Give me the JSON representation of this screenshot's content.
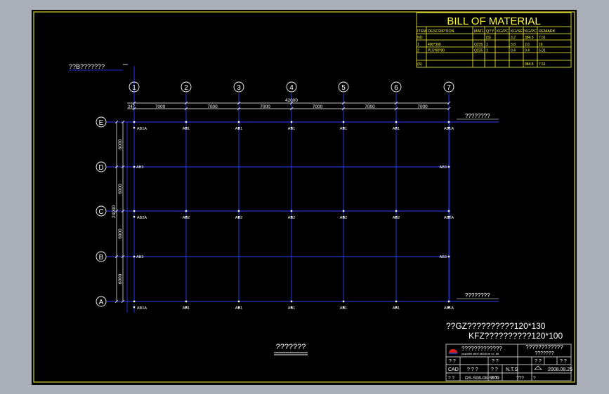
{
  "bom": {
    "title": "BILL OF MATERIAL",
    "headers": [
      "ITEM",
      "DESCRIPTION",
      "MATL",
      "QTY",
      "KG/PC",
      "KG/SET",
      "KG/PC",
      "REMARK"
    ],
    "row0": [
      "NO",
      "",
      "",
      "(S)",
      "",
      "3.2",
      "384.5",
      "7.51"
    ],
    "rows": [
      [
        "1",
        "400*300",
        "Q235",
        "1",
        "",
        "3.8",
        "2.6",
        "16"
      ],
      [
        "2",
        "PL5*80*80",
        "Q235",
        "1",
        "",
        "0.4",
        "0.4",
        "5.01"
      ]
    ],
    "total": [
      "(S)",
      "",
      "",
      "",
      "",
      "",
      "384.5",
      "7.51"
    ]
  },
  "drawing": {
    "top_note": "??B???????",
    "col_labels": [
      "1",
      "2",
      "3",
      "4",
      "5",
      "6",
      "7"
    ],
    "row_labels": [
      "E",
      "D",
      "C",
      "B",
      "A"
    ],
    "span_dims": [
      "7000",
      "7000",
      "7000",
      "7000",
      "7000",
      "7000"
    ],
    "total_length": "42000",
    "edge_dim": "247",
    "side_dims": [
      "6000",
      "6000",
      "6000",
      "6000"
    ],
    "total_width": "24000",
    "right_note_top": "????????",
    "right_note_bottom": "????????",
    "anchor_row_e": [
      "AB1A",
      "AB1",
      "AB1",
      "AB1",
      "AB1",
      "AB1",
      "AB1A"
    ],
    "anchor_row_d": [
      "AB3",
      "AB3"
    ],
    "anchor_row_c": [
      "AB2A",
      "AB2",
      "AB2",
      "AB2",
      "AB2",
      "AB2",
      "AB2A"
    ],
    "anchor_row_b": [
      "AB3",
      "AB3"
    ],
    "anchor_row_a": [
      "AB1A",
      "AB1",
      "AB1",
      "AB1",
      "AB1",
      "AB1",
      "AB1A"
    ]
  },
  "notes": {
    "line1": "??GZ??????????120*130",
    "line2": "KFZ??????????120*100"
  },
  "plan_title": "???????",
  "title_block": {
    "company": "?????????????",
    "company_sub": "yuandeli steel structure co.,ltd",
    "project": "????????????",
    "project2": "???????",
    "r2": [
      "? ?",
      "? ?",
      "? ?",
      "? ?"
    ],
    "r3": [
      "CAD",
      "? ? ?",
      "? ?",
      "N.T.S",
      "2008.08.25"
    ],
    "r4": [
      "? ?",
      "DS-S08-08-5009",
      "? ?",
      "???",
      "?"
    ]
  },
  "colors": {
    "background": "#000000",
    "frame": "#ffff3c",
    "grid": "#2d3cff",
    "text": "#ffffff",
    "bubble": "#ffffff"
  }
}
